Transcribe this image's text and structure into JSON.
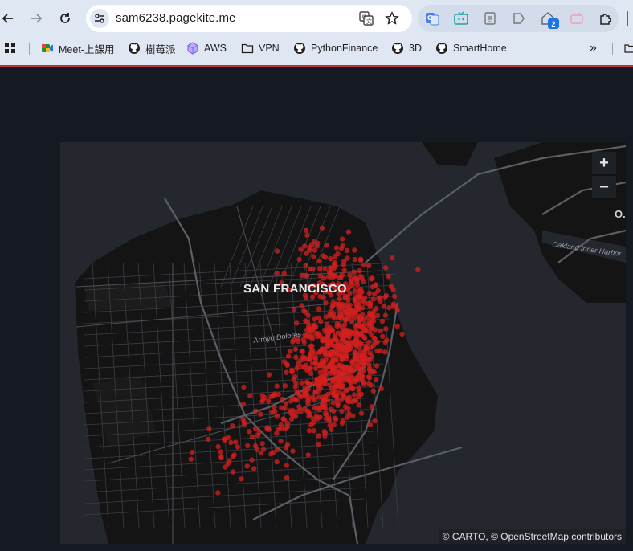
{
  "browser": {
    "url": "sam6238.pagekite.me",
    "extension_badge": "2",
    "bookmarks": [
      {
        "label": "Meet-上課用",
        "icon": "google-meet-icon"
      },
      {
        "label": "樹莓派",
        "icon": "github-icon"
      },
      {
        "label": "AWS",
        "icon": "cube-icon"
      },
      {
        "label": "VPN",
        "icon": "folder-icon"
      },
      {
        "label": "PythonFinance",
        "icon": "github-icon"
      },
      {
        "label": "3D",
        "icon": "github-icon"
      },
      {
        "label": "SmartHome",
        "icon": "github-icon"
      }
    ],
    "more_bookmarks_label": "»"
  },
  "map": {
    "city_label": "SAN FRANCISCO",
    "area_label": "Arroyo Dolores",
    "road_label": "Oakland Inner Harbor",
    "edge_label": "O.",
    "zoom_in_label": "+",
    "zoom_out_label": "−",
    "attribution": {
      "carto": "© CARTO",
      "sep": ", © ",
      "osm": "OpenStreetMap",
      "contributors": " contributors"
    },
    "point_color": "#d3201f",
    "background_color": "#24282e"
  }
}
